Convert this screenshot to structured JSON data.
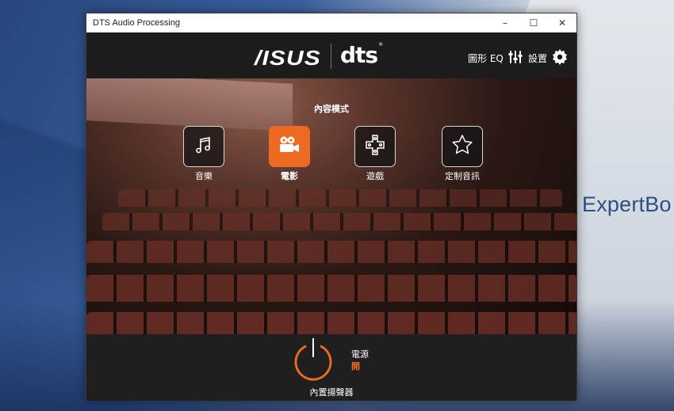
{
  "desktop": {
    "wallpaper_text": "ExpertBo"
  },
  "window": {
    "title": "DTS Audio Processing",
    "controls": {
      "minimize": "–",
      "maximize": "☐",
      "close": "✕"
    }
  },
  "header": {
    "brand_asus": "/ISUS",
    "brand_dts": "dts",
    "eq_label": "圖形 EQ",
    "settings_label": "設置"
  },
  "content": {
    "title": "內容模式",
    "modes": [
      {
        "label": "音樂",
        "icon": "music-note-icon",
        "active": false
      },
      {
        "label": "電影",
        "icon": "movie-camera-icon",
        "active": true
      },
      {
        "label": "遊戲",
        "icon": "gamepad-icon",
        "active": false
      },
      {
        "label": "定制音訊",
        "icon": "star-icon",
        "active": false
      }
    ]
  },
  "power": {
    "label": "電源",
    "state": "開",
    "device": "內置揚聲器"
  },
  "colors": {
    "accent": "#ec6a22",
    "background": "#1b1b1b"
  }
}
